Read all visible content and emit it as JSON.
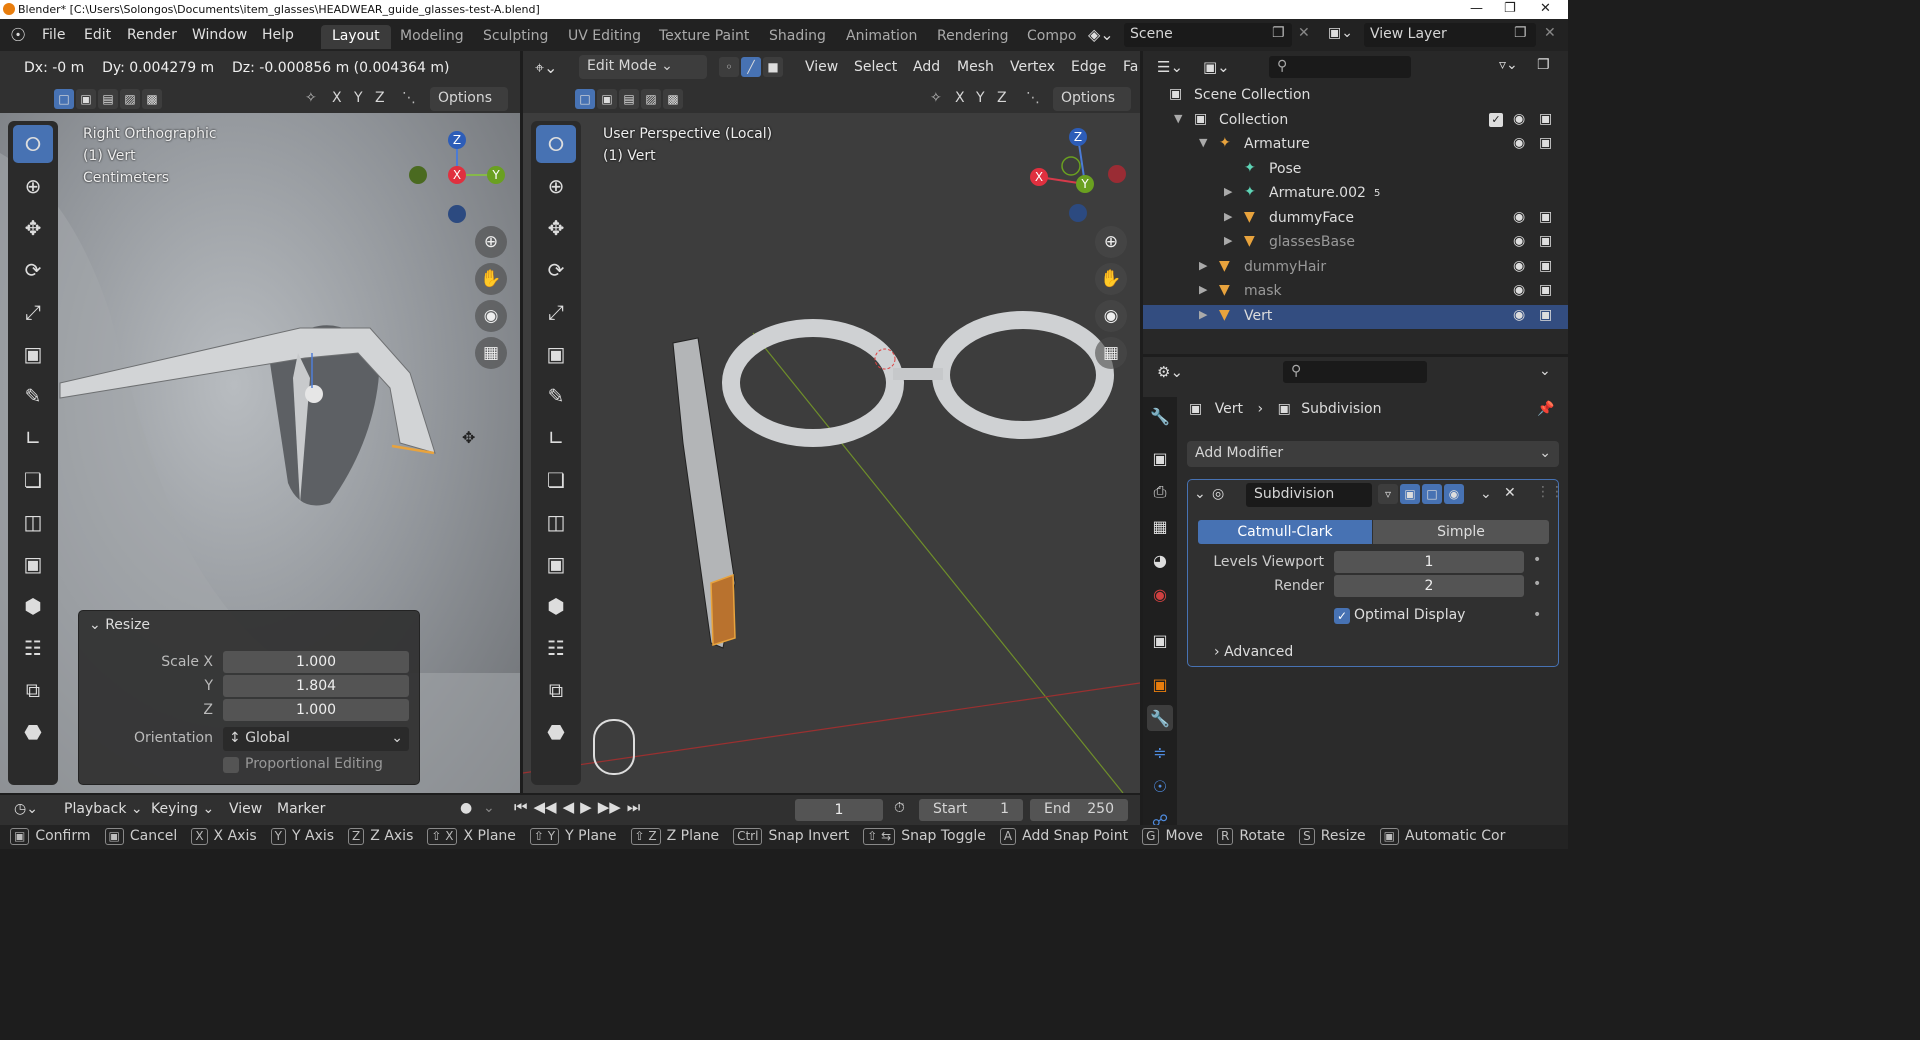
{
  "window": {
    "title": "Blender* [C:\\Users\\Solongos\\Documents\\item_glasses\\HEADWEAR_guide_glasses-test-A.blend]"
  },
  "menu": [
    "File",
    "Edit",
    "Render",
    "Window",
    "Help"
  ],
  "workspaces": [
    "Layout",
    "Modeling",
    "Sculpting",
    "UV Editing",
    "Texture Paint",
    "Shading",
    "Animation",
    "Rendering",
    "Compo"
  ],
  "scene": {
    "name": "Scene",
    "view_layer": "View Layer"
  },
  "left_view": {
    "header_info": "Dx: -0 m    Dy: 0.004279 m    Dz: -0.000856 m (0.004364 m)",
    "axes": [
      "X",
      "Y",
      "Z"
    ],
    "options_label": "Options",
    "overlay": [
      "Right Orthographic",
      "(1) Vert",
      "Centimeters"
    ],
    "gizmo": {
      "z": "Z",
      "x": "X",
      "y": "Y"
    }
  },
  "mid_view": {
    "mode": "Edit Mode",
    "menu": [
      "View",
      "Select",
      "Add",
      "Mesh",
      "Vertex",
      "Edge",
      "Fa"
    ],
    "axes": [
      "X",
      "Y",
      "Z"
    ],
    "options_label": "Options",
    "overlay": [
      "User Perspective (Local)",
      "(1) Vert"
    ],
    "gizmo": {
      "z": "Z",
      "x": "X",
      "y": "Y"
    }
  },
  "resize_panel": {
    "title": "Resize",
    "scale_label": "Scale X",
    "y_label": "Y",
    "z_label": "Z",
    "scale_x": "1.000",
    "scale_y": "1.804",
    "scale_z": "1.000",
    "orientation_label": "Orientation",
    "orientation_value": "Global",
    "proportional_label": "Proportional Editing"
  },
  "outliner": {
    "rows": [
      {
        "label": "Scene Collection",
        "indent": 0
      },
      {
        "label": "Collection",
        "indent": 1
      },
      {
        "label": "Armature",
        "indent": 2
      },
      {
        "label": "Pose",
        "indent": 3
      },
      {
        "label": "Armature.002",
        "indent": 3,
        "badge": "5"
      },
      {
        "label": "dummyFace",
        "indent": 3
      },
      {
        "label": "glassesBase",
        "indent": 3,
        "dim": true
      },
      {
        "label": "dummyHair",
        "indent": 2,
        "dim": true
      },
      {
        "label": "mask",
        "indent": 2,
        "dim": true
      },
      {
        "label": "Vert",
        "indent": 2,
        "selected": true
      }
    ]
  },
  "properties": {
    "breadcrumb_obj": "Vert",
    "breadcrumb_mod": "Subdivision",
    "add_modifier": "Add Modifier",
    "modifier_name": "Subdivision",
    "catmull": "Catmull-Clark",
    "simple": "Simple",
    "levels_viewport_label": "Levels Viewport",
    "levels_viewport": "1",
    "render_label": "Render",
    "render_value": "2",
    "optimal_display": "Optimal Display",
    "advanced": "Advanced"
  },
  "timeline": {
    "menus": [
      "Playback",
      "Keying",
      "View",
      "Marker"
    ],
    "current_frame": "1",
    "start_label": "Start",
    "start": "1",
    "end_label": "End",
    "end": "250"
  },
  "status": [
    {
      "key": "",
      "label": "Confirm"
    },
    {
      "key": "",
      "label": "Cancel"
    },
    {
      "key": "X",
      "label": "X Axis"
    },
    {
      "key": "Y",
      "label": "Y Axis"
    },
    {
      "key": "Z",
      "label": "Z Axis"
    },
    {
      "key": "⇧ X",
      "label": "X Plane"
    },
    {
      "key": "⇧ Y",
      "label": "Y Plane"
    },
    {
      "key": "⇧ Z",
      "label": "Z Plane"
    },
    {
      "key": "Ctrl",
      "label": "Snap Invert"
    },
    {
      "key": "⇧ ⇆",
      "label": "Snap Toggle"
    },
    {
      "key": "A",
      "label": "Add Snap Point"
    },
    {
      "key": "G",
      "label": "Move"
    },
    {
      "key": "R",
      "label": "Rotate"
    },
    {
      "key": "S",
      "label": "Resize"
    },
    {
      "key": "",
      "label": "Automatic Cor"
    }
  ],
  "colors": {
    "accent": "#4772b3",
    "selected_row": "#334d80",
    "edge_select": "#e8a33d"
  }
}
